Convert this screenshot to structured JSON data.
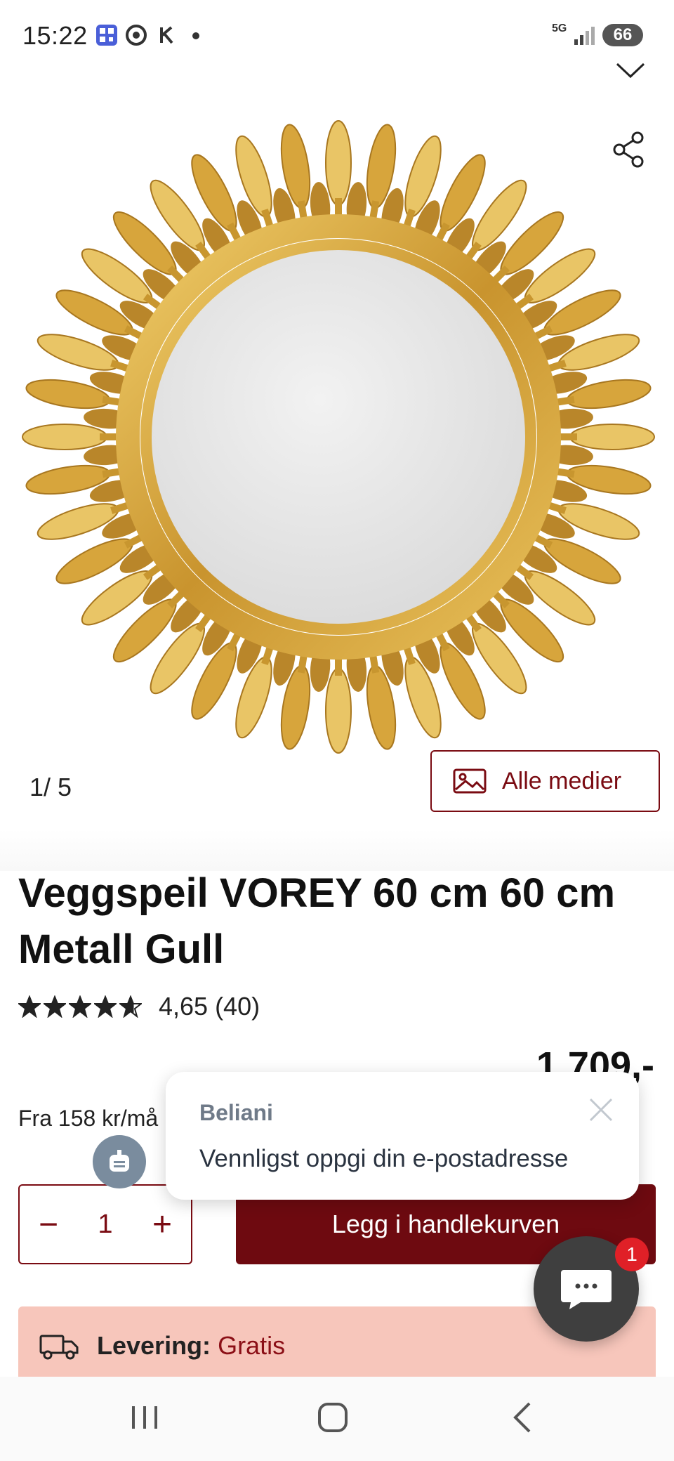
{
  "status_bar": {
    "time": "15:22",
    "network": "5G",
    "battery": "66"
  },
  "gallery": {
    "counter": "1/ 5",
    "all_media_label": "Alle medier"
  },
  "product": {
    "title": "Veggspeil VOREY 60 cm 60 cm Metall Gull",
    "rating_stars": 4.65,
    "rating_text": "4,65 (40)",
    "price": "1 709,-",
    "from_price": "Fra 158 kr/må"
  },
  "cart": {
    "quantity": "1",
    "minus_symbol": "−",
    "plus_symbol": "+",
    "add_to_cart_label": "Legg i handlekurven"
  },
  "delivery": {
    "label": "Levering:",
    "value": "Gratis"
  },
  "chat_popup": {
    "brand": "Beliani",
    "message": "Vennligst oppgi din e-postadresse"
  },
  "chat_fab": {
    "badge_count": "1"
  },
  "colors": {
    "brand_red": "#6e0a10",
    "delivery_bg": "#f7c6bb",
    "badge_red": "#e02027"
  }
}
